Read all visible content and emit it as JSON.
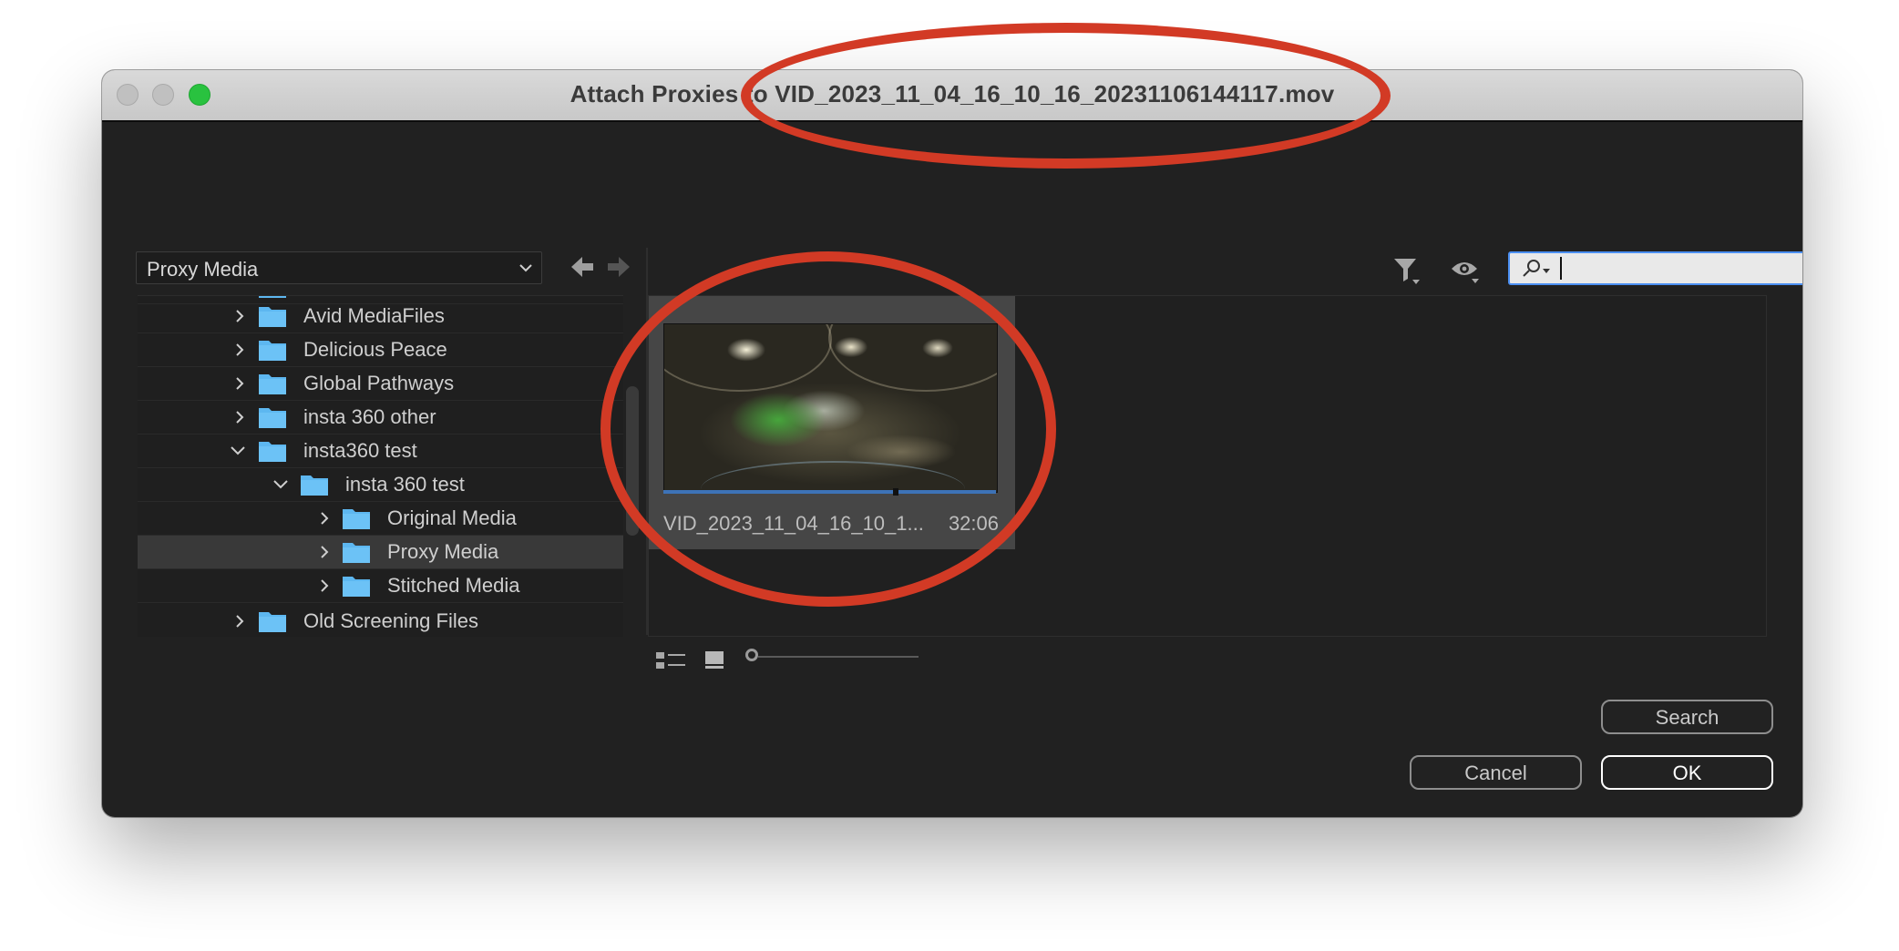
{
  "window": {
    "title": "Attach Proxies to VID_2023_11_04_16_10_16_20231106144117.mov"
  },
  "location": {
    "selected": "Proxy Media"
  },
  "tree": {
    "items": [
      {
        "label": "Avid MediaFiles",
        "expanded": false,
        "selected": false
      },
      {
        "label": "Delicious Peace",
        "expanded": false,
        "selected": false
      },
      {
        "label": "Global Pathways",
        "expanded": false,
        "selected": false
      },
      {
        "label": "insta 360 other",
        "expanded": false,
        "selected": false
      },
      {
        "label": "insta360 test",
        "expanded": true,
        "selected": false
      },
      {
        "label": "insta 360 test",
        "expanded": true,
        "selected": false
      },
      {
        "label": "Original Media",
        "expanded": false,
        "selected": false
      },
      {
        "label": "Proxy Media",
        "expanded": false,
        "selected": true
      },
      {
        "label": "Stitched Media",
        "expanded": false,
        "selected": false
      },
      {
        "label": "Old Screening Files",
        "expanded": false,
        "selected": false
      }
    ]
  },
  "media": {
    "items": [
      {
        "name": "VID_2023_11_04_16_10_1...",
        "duration": "32:06"
      }
    ]
  },
  "search": {
    "value": "",
    "placeholder": ""
  },
  "buttons": {
    "search": "Search",
    "cancel": "Cancel",
    "ok": "OK"
  },
  "colors": {
    "annotation": "#d23a25",
    "accent": "#4b8ff2",
    "folder": "#5db7f0",
    "background": "#212121"
  },
  "icons": {
    "back": "arrow-left-icon",
    "forward": "arrow-right-icon",
    "filter": "filter-icon",
    "view": "eye-icon",
    "search": "magnifier-icon",
    "list_view": "list-view-icon",
    "icon_view": "icon-view-icon"
  }
}
